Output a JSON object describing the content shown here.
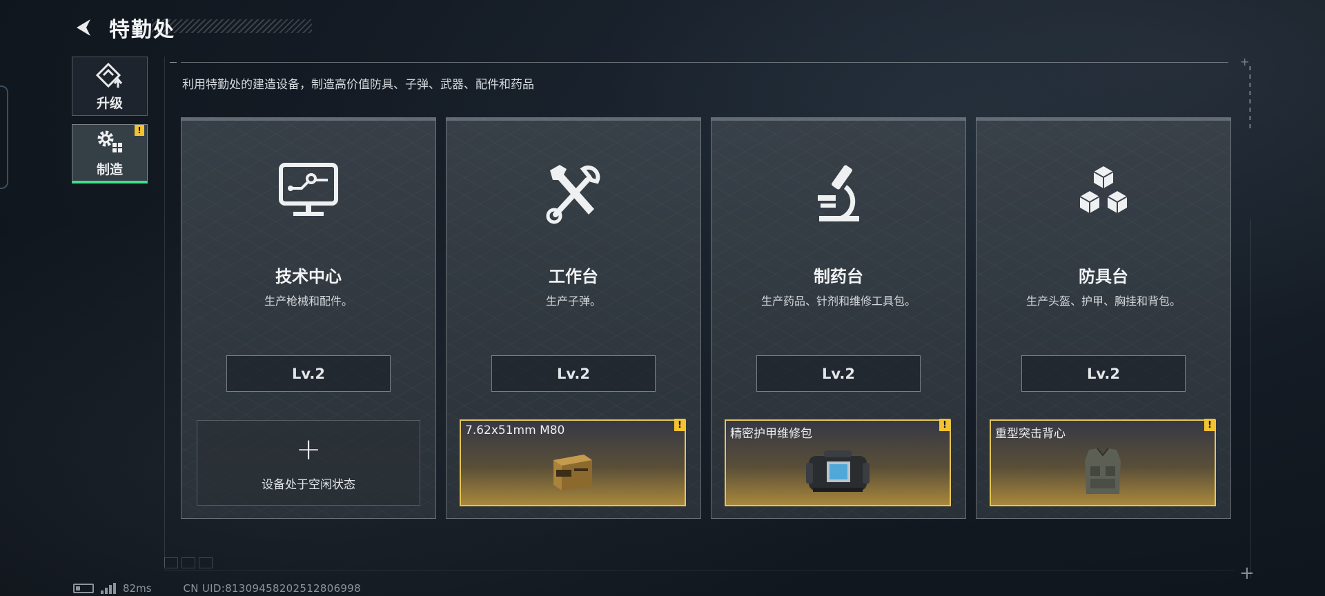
{
  "header": {
    "title": "特勤处",
    "back_icon": "back-arrow-icon"
  },
  "side_nav": {
    "items": [
      {
        "label": "升级",
        "icon": "upgrade-icon",
        "active": false,
        "badge": ""
      },
      {
        "label": "制造",
        "icon": "gears-icon",
        "active": true,
        "badge": "!"
      }
    ]
  },
  "description": "利用特勤处的建造设备，制造高价值防具、子弹、武器、配件和药品",
  "cards": [
    {
      "title": "技术中心",
      "desc": "生产枪械和配件。",
      "icon": "monitor-circuit-icon",
      "level": "Lv.2",
      "slot": {
        "state": "idle",
        "text": "设备处于空闲状态",
        "plus": "+"
      }
    },
    {
      "title": "工作台",
      "desc": "生产子弹。",
      "icon": "hammer-wrench-icon",
      "level": "Lv.2",
      "slot": {
        "state": "active",
        "item": "7.62x51mm M80",
        "badge": "!",
        "item_icon": "ammo-box-icon"
      }
    },
    {
      "title": "制药台",
      "desc": "生产药品、针剂和维修工具包。",
      "icon": "microscope-icon",
      "level": "Lv.2",
      "slot": {
        "state": "active",
        "item": "精密护甲维修包",
        "badge": "!",
        "item_icon": "repair-kit-icon"
      }
    },
    {
      "title": "防具台",
      "desc": "生产头盔、护甲、胸挂和背包。",
      "icon": "cubes-icon",
      "level": "Lv.2",
      "slot": {
        "state": "active",
        "item": "重型突击背心",
        "badge": "!",
        "item_icon": "vest-icon"
      }
    }
  ],
  "status": {
    "ping": "82ms",
    "uid": "CN UID:81309458202512806998"
  },
  "colors": {
    "accent_green": "#3fe28b",
    "badge_yellow": "#f2c230",
    "slot_border": "#e6c653"
  }
}
